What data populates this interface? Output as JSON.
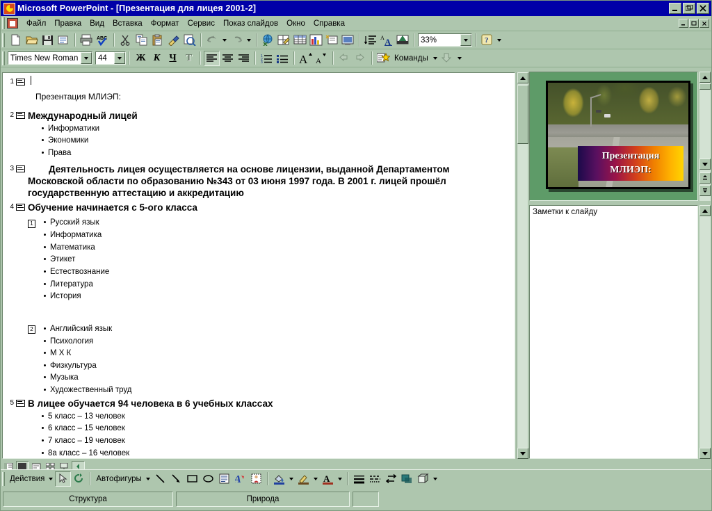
{
  "window": {
    "app_title": "Microsoft PowerPoint - [Презентация для лицея 2001-2]",
    "minimize_label": "_",
    "restore_label": "restore",
    "close_label": "✕",
    "doc_minimize": "_",
    "doc_restore": "□",
    "doc_close": "×"
  },
  "menu": {
    "items": [
      {
        "label": "Файл"
      },
      {
        "label": "Правка"
      },
      {
        "label": "Вид"
      },
      {
        "label": "Вставка"
      },
      {
        "label": "Формат"
      },
      {
        "label": "Сервис"
      },
      {
        "label": "Показ слайдов"
      },
      {
        "label": "Окно"
      },
      {
        "label": "Справка"
      }
    ]
  },
  "standard_toolbar": {
    "zoom_value": "33%",
    "buttons": [
      "new-document-icon",
      "open-folder-icon",
      "save-disk-icon",
      "mail-icon",
      "print-icon",
      "spellcheck-icon",
      "cut-scissors-icon",
      "copy-icon",
      "paste-clipboard-icon",
      "format-painter-icon",
      "preview-icon",
      "undo-icon",
      "redo-icon",
      "hyperlink-globe-icon",
      "tables-and-borders-icon",
      "insert-table-icon",
      "insert-chart-icon",
      "new-slide-icon",
      "slide-design-icon",
      "expand-all-icon",
      "format-text-icon",
      "show-formatting-icon",
      "help-icon"
    ]
  },
  "formatting_toolbar": {
    "font_name": "Times New Roman",
    "font_size": "44",
    "bold_label": "Ж",
    "italic_label": "К",
    "underline_label": "Ч",
    "shadow_label": "T",
    "commands_label": "Команды",
    "buttons": [
      "align-left-icon",
      "align-center-icon",
      "align-right-icon",
      "numbered-list-icon",
      "bulleted-list-icon",
      "increase-font-size-icon",
      "decrease-font-size-icon",
      "promote-icon",
      "demote-icon",
      "animation-effects-icon",
      "commands-menu",
      "more-buttons-icon"
    ]
  },
  "outline": {
    "slides": [
      {
        "number": "1",
        "title": "",
        "title_has_caret": true,
        "subtitle": "Презентация МЛИЭП:",
        "bullets": []
      },
      {
        "number": "2",
        "title": "Международный лицей",
        "bullets": [
          "Информатики",
          "Экономики",
          "Права"
        ]
      },
      {
        "number": "3",
        "title": "        Деятельность лицея осуществляется на основе лицензии, выданной Департаментом Московской области по образованию №343 от 03 июня 1997 года. В 2001 г. лицей прошёл государственную аттестацию и аккредитацию",
        "bullets": []
      },
      {
        "number": "4",
        "title": "Обучение  начинается  с  5-ого  класса",
        "columns": [
          {
            "marker": "1",
            "bullets": [
              "Русский язык",
              "Информатика",
              "Математика",
              "Этикет",
              "Естествознание",
              "Литература",
              "История"
            ]
          },
          {
            "marker": "2",
            "bullets": [
              "Английский язык",
              "Психология",
              "М Х К",
              "Физкультура",
              "Музыка",
              "Художественный  труд"
            ]
          }
        ],
        "bullets": []
      },
      {
        "number": "5",
        "title": "В лицее обучается 94 человека в 6 учебных классах",
        "bullets": [
          "5 класс – 13 человек",
          "6 класс – 15 человек",
          "7 класс – 19 человек",
          "8а класс – 16 человек"
        ]
      }
    ]
  },
  "slide_preview": {
    "title_line1": "Презентация",
    "title_line2": "МЛИЭП:",
    "alt": "Осенний вид на территорию лицея"
  },
  "notes": {
    "placeholder": "Заметки к слайду"
  },
  "view_buttons": [
    "normal-view-icon",
    "outline-view-icon",
    "slide-view-icon",
    "slide-sorter-view-icon",
    "slide-show-icon",
    "scroll-left-icon"
  ],
  "drawing_toolbar": {
    "actions_label": "Действия",
    "autoshapes_label": "Автофигуры",
    "buttons": [
      "select-arrow-icon",
      "free-rotate-icon",
      "line-icon",
      "arrow-icon",
      "rectangle-icon",
      "oval-icon",
      "text-box-icon",
      "wordart-icon",
      "clipart-icon",
      "fill-color-icon",
      "line-color-icon",
      "font-color-icon",
      "line-style-icon",
      "dash-style-icon",
      "arrow-style-icon",
      "shadow-icon",
      "3d-icon",
      "more-buttons-icon"
    ]
  },
  "status_bar": {
    "left_text": "Структура",
    "center_text": "Природа",
    "right_text": ""
  },
  "colors": {
    "titlebar_blue": "#0000a8",
    "chrome_green": "#aec6ae",
    "slide_pane_green": "#5e9b68",
    "white": "#ffffff"
  }
}
